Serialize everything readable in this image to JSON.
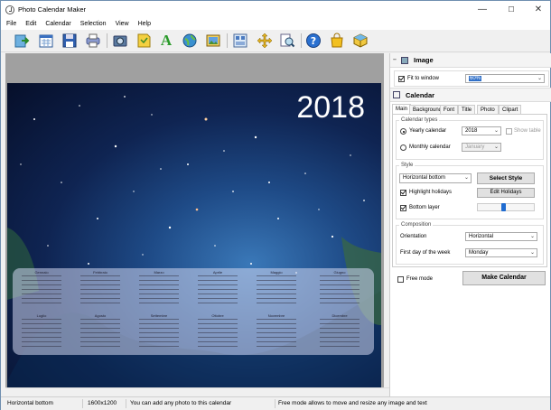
{
  "window": {
    "title": "Photo Calendar Maker",
    "min_glyph": "—",
    "max_glyph": "☐",
    "close_glyph": "✕"
  },
  "menu": [
    "File",
    "Edit",
    "Calendar",
    "Selection",
    "View",
    "Help"
  ],
  "toolbar": {
    "icons": [
      "open-photo-icon",
      "calendar-icon",
      "save-icon",
      "print-icon",
      "camera-icon",
      "clipart-icon",
      "text-icon",
      "globe-icon",
      "image-icon",
      "layout-icon",
      "move-icon",
      "zoom-icon",
      "help-icon",
      "shopping-bag-icon",
      "box-icon"
    ]
  },
  "canvas": {
    "year": "2018",
    "months": [
      "Gennaio",
      "Febbraio",
      "Marzo",
      "Aprile",
      "Maggio",
      "Giugno",
      "Luglio",
      "Agosto",
      "Settembre",
      "Ottobre",
      "Novembre",
      "Dicembre"
    ]
  },
  "panel": {
    "image": {
      "title": "Image",
      "fit_label": "Fit to window",
      "zoom_value": "60%"
    },
    "calendar": {
      "title": "Calendar",
      "tabs": [
        "Main",
        "Background",
        "Font",
        "Title",
        "Photo",
        "Clipart"
      ],
      "types": {
        "title": "Calendar types",
        "yearly": "Yearly calendar",
        "year_value": "2018",
        "show_table": "Show table",
        "monthly": "Monthly calendar",
        "month_value": "January"
      },
      "style": {
        "title": "Style",
        "style_value": "Horizontal bottom",
        "select_btn": "Select Style",
        "highlight": "Highlight holidays",
        "edit_btn": "Edit Holidays",
        "bottom_layer": "Bottom layer"
      },
      "composition": {
        "title": "Composition",
        "orientation_label": "Orientation",
        "orientation_value": "Horizontal",
        "first_day_label": "First day of the week",
        "first_day_value": "Monday"
      },
      "free_mode": "Free mode",
      "make_btn": "Make Calendar"
    }
  },
  "status": {
    "style": "Horizontal bottom",
    "size": "1600x1200",
    "hint": "You can add any photo to this calendar",
    "free_hint": "Free mode allows to move and resize any image and text"
  }
}
